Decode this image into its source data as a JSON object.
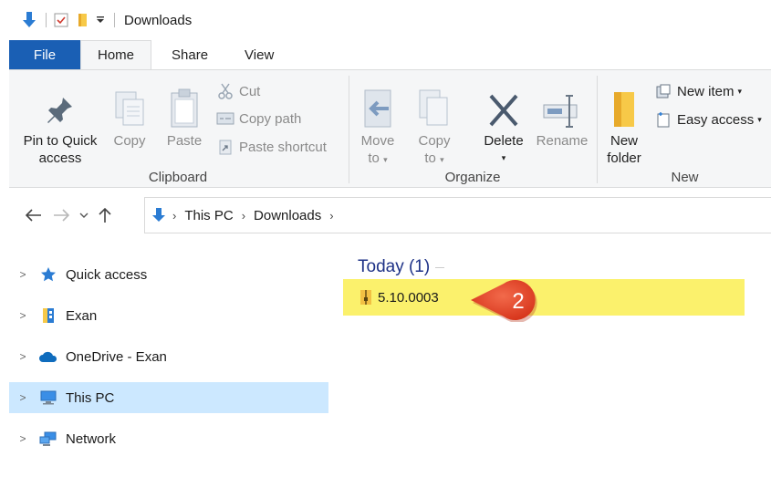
{
  "window": {
    "title": "Downloads"
  },
  "ribbon_tabs": [
    "File",
    "Home",
    "Share",
    "View"
  ],
  "clipboard": {
    "pin_label_1": "Pin to Quick",
    "pin_label_2": "access",
    "copy": "Copy",
    "paste": "Paste",
    "cut": "Cut",
    "copy_path": "Copy path",
    "paste_shortcut": "Paste shortcut",
    "group_label": "Clipboard"
  },
  "organize": {
    "move_to_1": "Move",
    "move_to_2": "to",
    "copy_to_1": "Copy",
    "copy_to_2": "to",
    "delete": "Delete",
    "rename": "Rename",
    "group_label": "Organize"
  },
  "new": {
    "new_folder_1": "New",
    "new_folder_2": "folder",
    "new_item": "New item",
    "easy_access": "Easy access",
    "group_label": "New"
  },
  "address": {
    "breadcrumbs": [
      "This PC",
      "Downloads"
    ]
  },
  "nav_pane": {
    "items": [
      {
        "label": "Quick access",
        "icon": "star-icon"
      },
      {
        "label": "Exan",
        "icon": "user-folder-icon"
      },
      {
        "label": "OneDrive - Exan",
        "icon": "cloud-icon"
      },
      {
        "label": "This PC",
        "icon": "computer-icon",
        "selected": true
      },
      {
        "label": "Network",
        "icon": "network-icon"
      }
    ]
  },
  "content": {
    "group_header": "Today (1)",
    "files": [
      {
        "name": "5.10.0003",
        "icon": "zip-folder-icon"
      }
    ]
  },
  "annotation": {
    "number": "2",
    "color": "#e9452c"
  },
  "colors": {
    "file_tab": "#1a5fb4",
    "selected_nav": "#cce8ff",
    "highlight": "#fbf16c",
    "group_header": "#1e3287"
  }
}
